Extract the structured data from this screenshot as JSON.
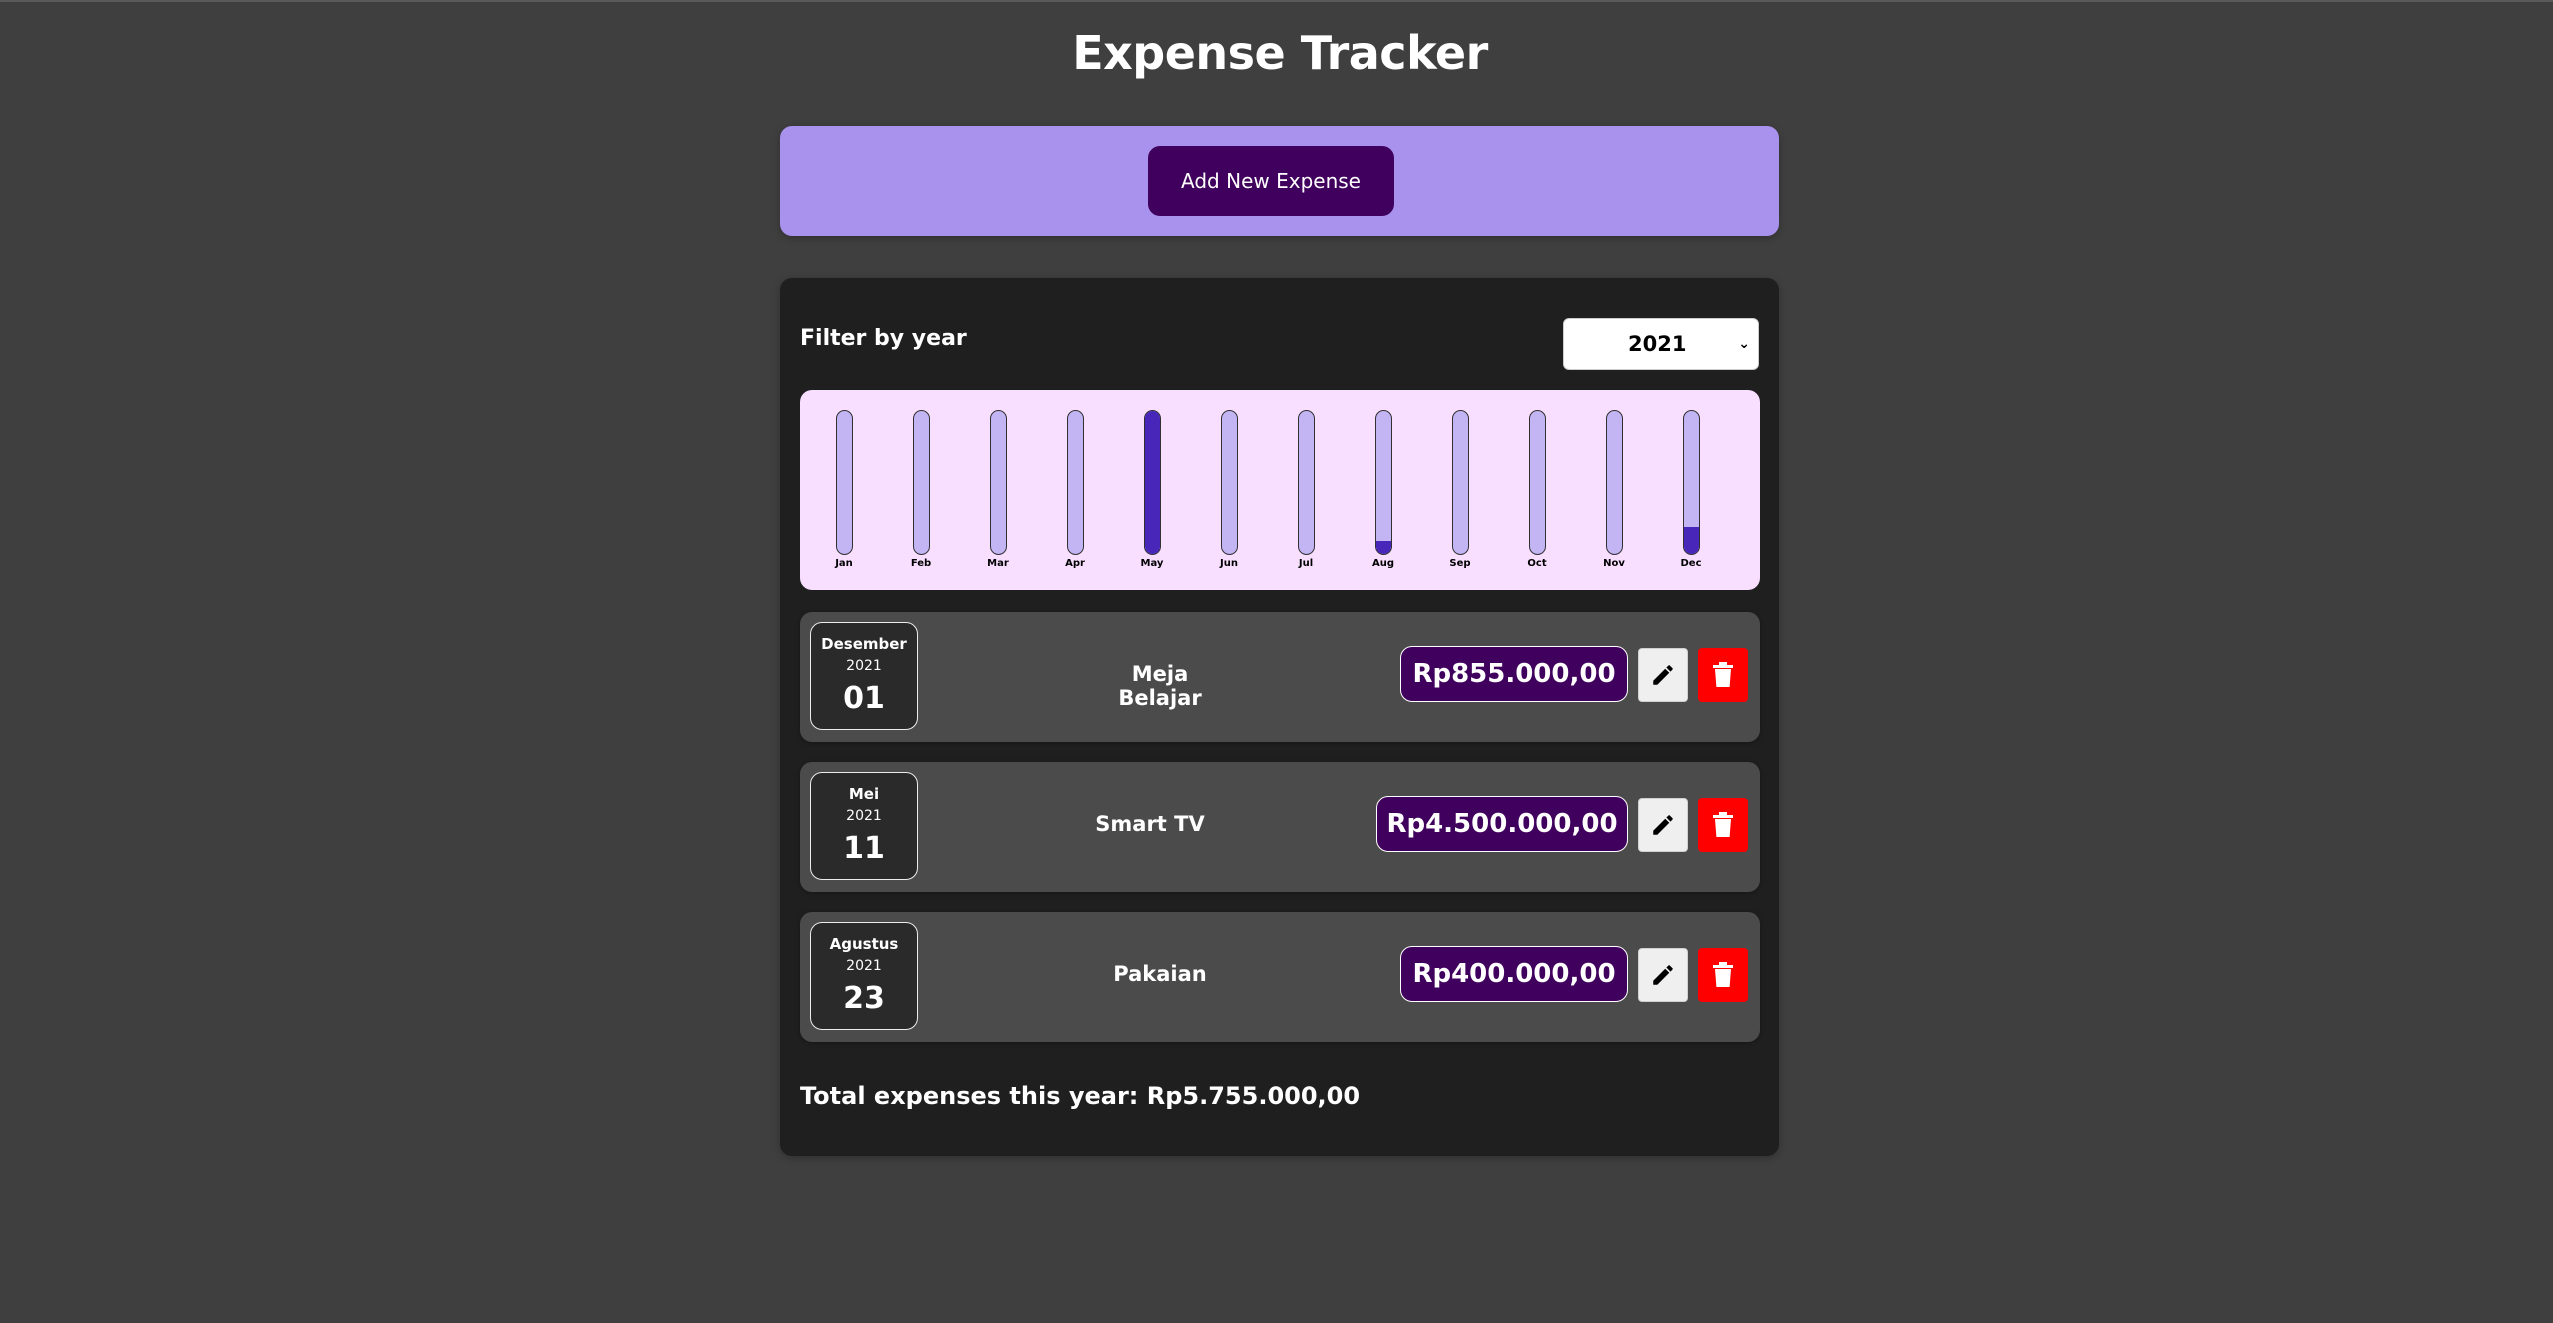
{
  "app": {
    "title": "Expense Tracker"
  },
  "new_expense": {
    "add_label": "Add New Expense"
  },
  "filter": {
    "label": "Filter by year",
    "selected_year": "2021"
  },
  "chart_data": {
    "type": "bar",
    "categories": [
      "Jan",
      "Feb",
      "Mar",
      "Apr",
      "May",
      "Jun",
      "Jul",
      "Aug",
      "Sep",
      "Oct",
      "Nov",
      "Dec"
    ],
    "values": [
      0,
      0,
      0,
      0,
      4500000,
      0,
      0,
      400000,
      0,
      0,
      0,
      855000
    ],
    "max": 4500000,
    "colors": {
      "fill": "#4826b9",
      "track": "#c3b4f3",
      "background": "#f8dfff"
    }
  },
  "expenses": [
    {
      "month": "Desember",
      "year": "2021",
      "day": "01",
      "title": "Meja Belajar",
      "amount": "Rp855.000,00"
    },
    {
      "month": "Mei",
      "year": "2021",
      "day": "11",
      "title": "Smart TV",
      "amount": "Rp4.500.000,00"
    },
    {
      "month": "Agustus",
      "year": "2021",
      "day": "23",
      "title": "Pakaian",
      "amount": "Rp400.000,00"
    }
  ],
  "actions": {
    "edit_icon": "pencil-icon",
    "delete_icon": "trash-icon"
  },
  "total": {
    "text": "Total expenses this year: Rp5.755.000,00"
  },
  "colors": {
    "page_bg": "#3f3f3f",
    "panel_bg": "#1f1f1f",
    "accent": "#40005d",
    "header_panel": "#a892ee",
    "delete": "#ff0000"
  }
}
